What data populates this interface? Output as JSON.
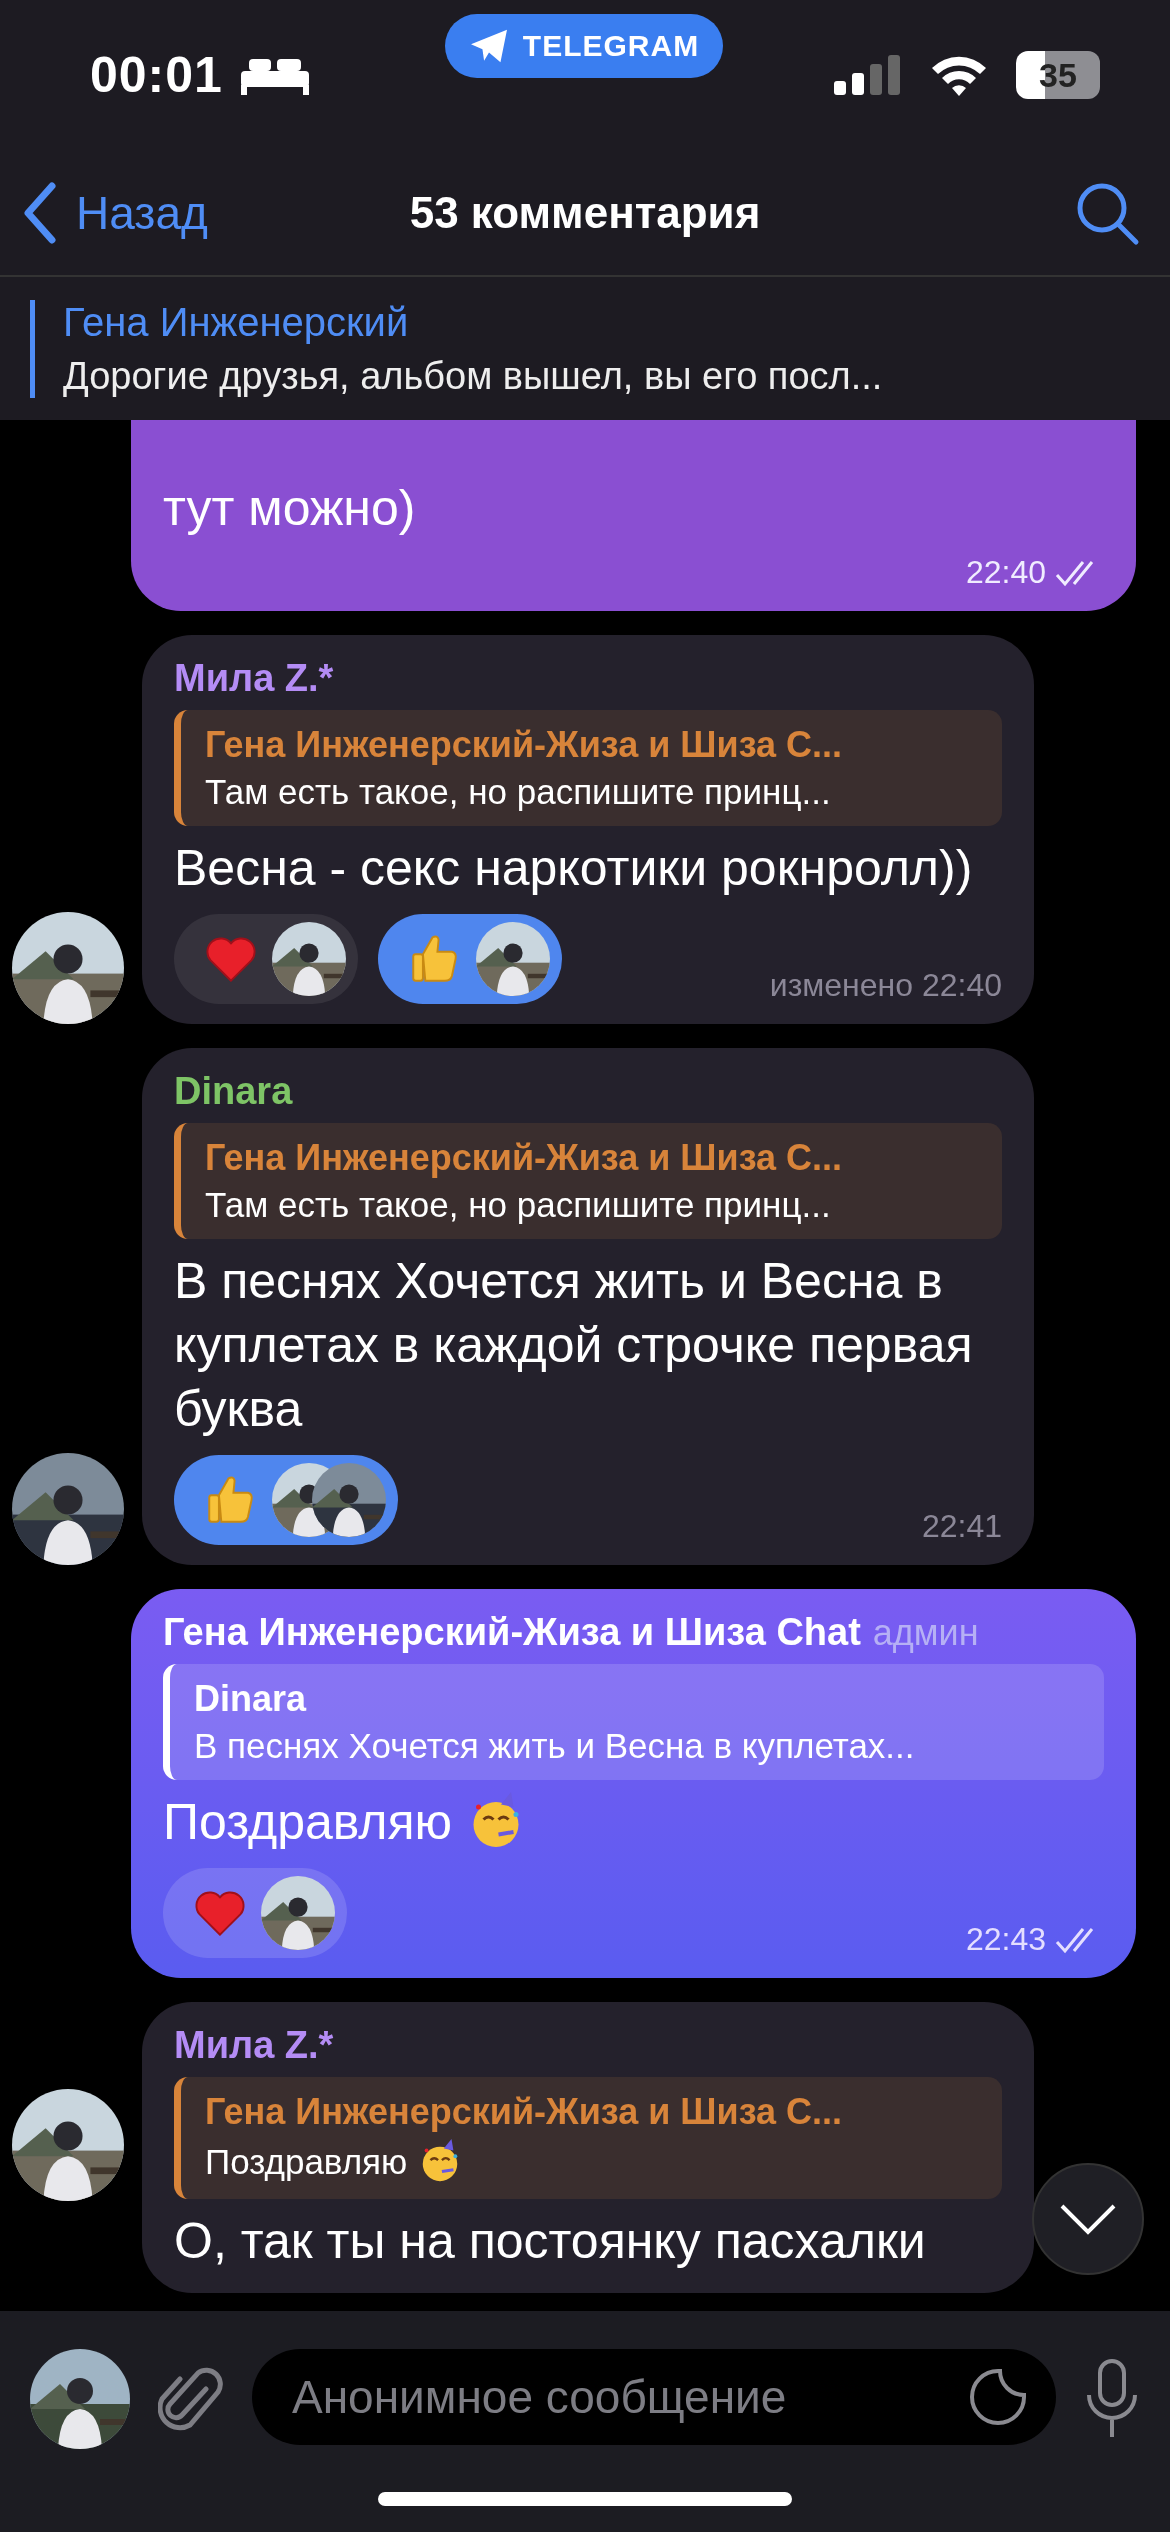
{
  "status_bar": {
    "time": "00:01",
    "app_pill": "TELEGRAM",
    "battery": "35"
  },
  "nav": {
    "back": "Назад",
    "title": "53 комментария"
  },
  "pinned": {
    "author": "Гена Инженерский",
    "text": "Дорогие друзья, альбом вышел, вы его посл..."
  },
  "messages": [
    {
      "kind": "outgoing",
      "text": "тут можно)",
      "time": "22:40",
      "read": true
    },
    {
      "kind": "incoming",
      "sender": "Мила Z.*",
      "color": "#b48cf5",
      "reply": {
        "author": "Гена Инженерский-Жиза и Шиза С...",
        "text": "Там есть такое, но распишите принц..."
      },
      "text": "Весна - секс наркотики рокнролл))",
      "reactions": [
        {
          "kind": "heart",
          "selected": false
        },
        {
          "kind": "thumbs_up",
          "selected": true
        }
      ],
      "time": "изменено 22:40"
    },
    {
      "kind": "incoming",
      "sender": "Dinara",
      "color": "#7ec466",
      "reply": {
        "author": "Гена Инженерский-Жиза и Шиза С...",
        "text": "Там есть такое, но распишите принц..."
      },
      "text": "В песнях Хочется жить и Весна в куплетах в каждой строчке первая буква",
      "reactions": [
        {
          "kind": "thumbs_up",
          "selected": true
        }
      ],
      "time": "22:41"
    },
    {
      "kind": "outgoing",
      "sender": "Гена Инженерский-Жиза и Шиза Chat",
      "role": "админ",
      "reply": {
        "author": "Dinara",
        "text": "В песнях Хочется жить и Весна в куплетах..."
      },
      "text": "Поздравляю",
      "party_emoji": true,
      "reactions": [
        {
          "kind": "heart",
          "selected": false
        }
      ],
      "time": "22:43",
      "read": true
    },
    {
      "kind": "incoming",
      "sender": "Мила Z.*",
      "color": "#b48cf5",
      "reply": {
        "author": "Гена Инженерский-Жиза и Шиза С...",
        "text": "Поздравляю",
        "party_emoji": true
      },
      "text": "О, так ты на постоянку пасхалки"
    }
  ],
  "composer": {
    "placeholder": "Анонимное сообщение"
  }
}
